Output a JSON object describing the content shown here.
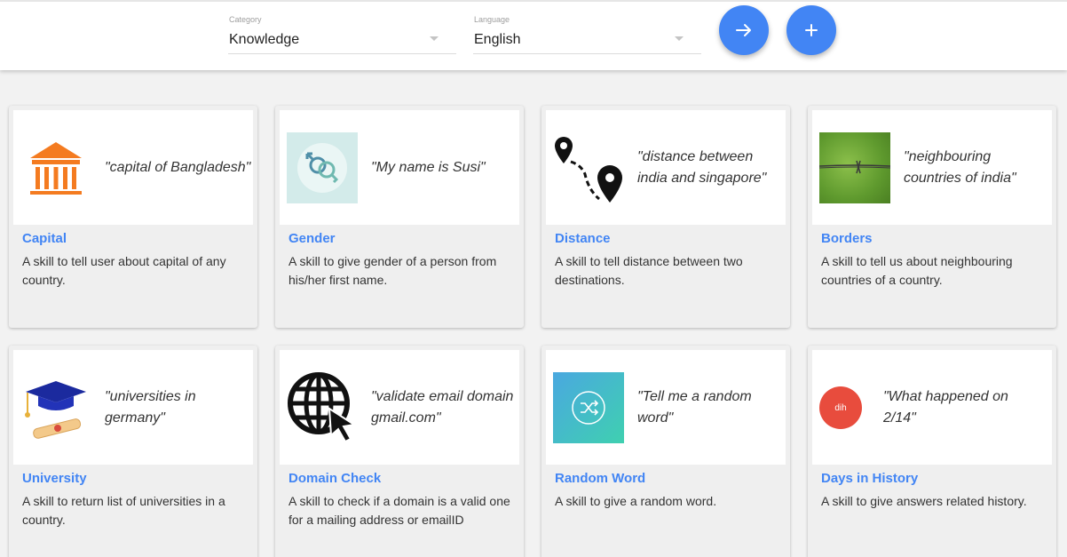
{
  "filters": {
    "category": {
      "label": "Category",
      "value": "Knowledge"
    },
    "language": {
      "label": "Language",
      "value": "English"
    }
  },
  "actions": {
    "next_icon": "arrow-right-icon",
    "add_icon": "plus-icon",
    "accent_color": "#4285f4"
  },
  "skills": [
    {
      "title": "Capital",
      "example": "\"capital of Bangladesh\"",
      "description": "A skill to tell user about capital of any country.",
      "icon": "government-building-icon"
    },
    {
      "title": "Gender",
      "example": "\"My name is Susi\"",
      "description": "A skill to give gender of a person from his/her first name.",
      "icon": "gender-symbols-icon"
    },
    {
      "title": "Distance",
      "example": "\"distance between india and singapore\"",
      "description": "A skill to tell distance between two destinations.",
      "icon": "route-pins-icon"
    },
    {
      "title": "Borders",
      "example": "\"neighbouring countries of india\"",
      "description": "A skill to tell us about neighbouring countries of a country.",
      "icon": "barbed-wire-image"
    },
    {
      "title": "University",
      "example": "\"universities in germany\"",
      "description": "A skill to return list of universities in a country.",
      "icon": "graduation-cap-icon"
    },
    {
      "title": "Domain Check",
      "example": "\"validate email domain gmail.com\"",
      "description": "A skill to check if a domain is a valid one for a mailing address or emailID",
      "icon": "globe-cursor-icon"
    },
    {
      "title": "Random Word",
      "example": "\"Tell me a random word\"",
      "description": "A skill to give a random word.",
      "icon": "shuffle-icon"
    },
    {
      "title": "Days in History",
      "example": "\"What happened on 2/14\"",
      "description": "A skill to give answers related history.",
      "icon": "dih-avatar",
      "avatar_text": "dih",
      "avatar_color": "#e84c3d"
    }
  ]
}
